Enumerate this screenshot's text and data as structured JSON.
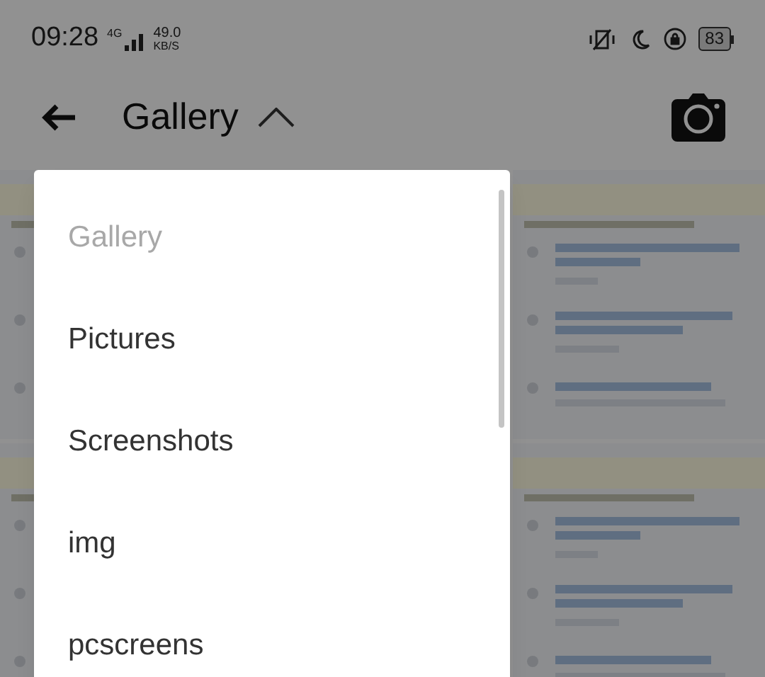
{
  "status_bar": {
    "time": "09:28",
    "network": "4G",
    "speed": "49.0",
    "speed_unit": "KB/S",
    "battery": "83"
  },
  "app_bar": {
    "title": "Gallery"
  },
  "album_menu": [
    {
      "label": "Gallery",
      "selected": true
    },
    {
      "label": "Pictures",
      "selected": false
    },
    {
      "label": "Screenshots",
      "selected": false
    },
    {
      "label": "img",
      "selected": false
    },
    {
      "label": "pcscreens",
      "selected": false
    }
  ]
}
